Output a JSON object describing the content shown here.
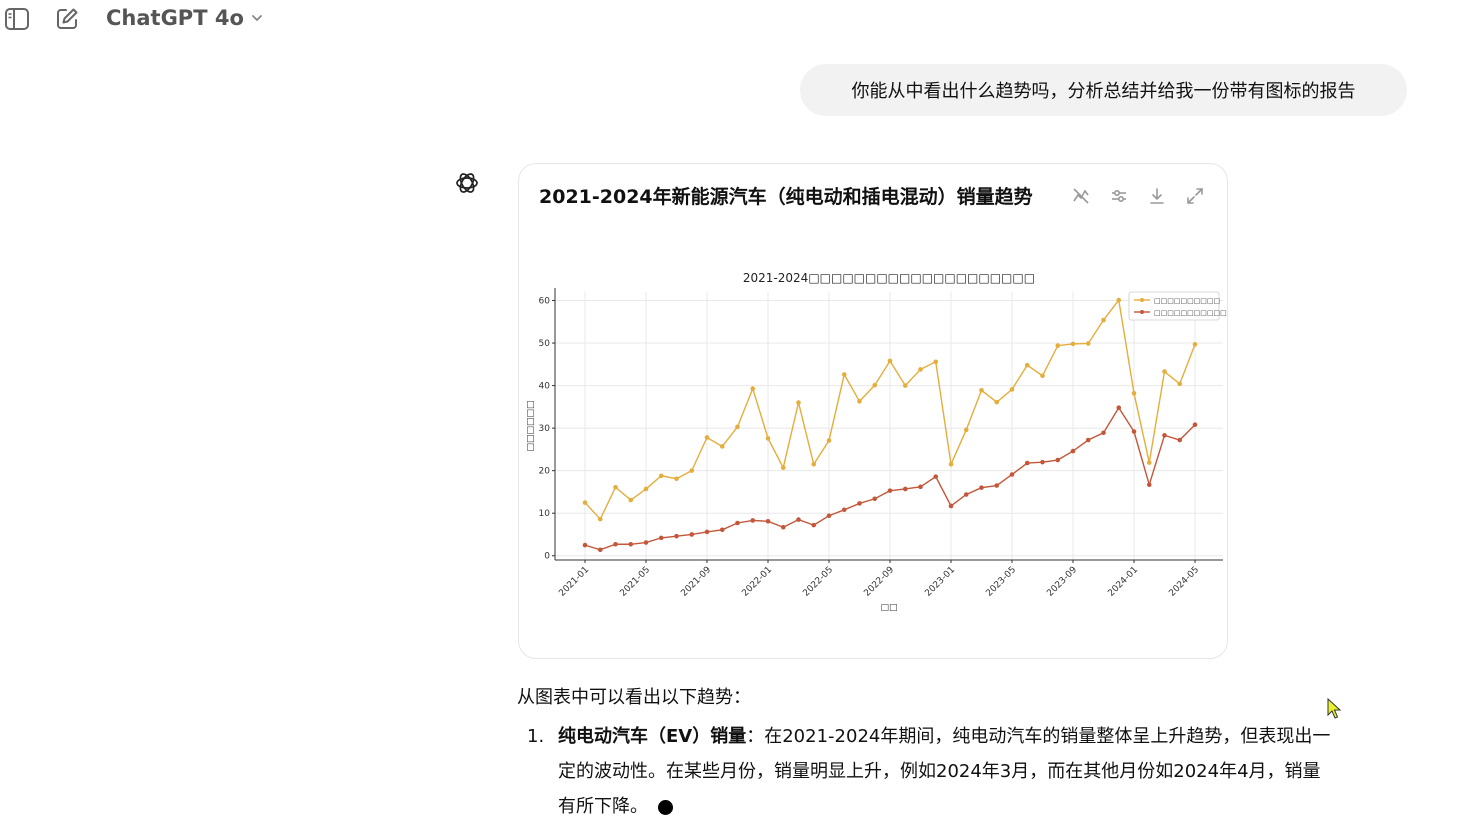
{
  "header": {
    "model_name": "ChatGPT 4o",
    "icons": [
      "sidebar-toggle-icon",
      "new-chat-icon",
      "chevron-down-icon"
    ]
  },
  "user_message": "你能从中看出什么趋势吗，分析总结并给我一份带有图标的报告",
  "chart_card": {
    "title": "2021-2024年新能源汽车（纯电动和插电混动）销量趋势",
    "tools": [
      "chart-switch-icon",
      "chart-settings-icon",
      "download-icon",
      "expand-icon"
    ]
  },
  "chart_data": {
    "type": "line",
    "title": "2021-2024□□□□□□□□□□□□□□□□□□□□",
    "xlabel": "□□",
    "ylabel": "□□□□□□",
    "ylim": [
      -1,
      62
    ],
    "yticks": [
      0,
      10,
      20,
      30,
      40,
      50,
      60
    ],
    "x_start": "2021-01",
    "x_end": "2024-05",
    "xticks": [
      "2021-01",
      "2021-05",
      "2021-09",
      "2022-01",
      "2022-05",
      "2022-09",
      "2023-01",
      "2023-05",
      "2023-09",
      "2024-01",
      "2024-05"
    ],
    "grid": true,
    "legend_position": "top-right",
    "series": [
      {
        "name": "□□□□□□□□□□",
        "color": "#e5ad3c",
        "values": [
          12.5,
          8.6,
          16.1,
          13.1,
          15.7,
          18.8,
          18.1,
          20.0,
          27.8,
          25.7,
          30.3,
          39.3,
          27.6,
          20.7,
          36.0,
          21.5,
          27.1,
          42.6,
          36.3,
          40.1,
          45.8,
          40.0,
          43.8,
          45.6,
          21.5,
          29.6,
          38.9,
          36.1,
          39.1,
          44.8,
          42.3,
          49.4,
          49.8,
          49.9,
          55.4,
          60.1,
          38.2,
          21.9,
          43.3,
          40.4,
          49.7
        ]
      },
      {
        "name": "□□□□□□□□□□□",
        "color": "#c4573a",
        "values": [
          2.5,
          1.4,
          2.7,
          2.7,
          3.1,
          4.2,
          4.6,
          5.0,
          5.6,
          6.1,
          7.7,
          8.3,
          8.1,
          6.7,
          8.5,
          7.2,
          9.4,
          10.8,
          12.3,
          13.4,
          15.3,
          15.7,
          16.2,
          18.6,
          11.7,
          14.4,
          16.0,
          16.5,
          19.1,
          21.8,
          22.0,
          22.5,
          24.6,
          27.2,
          28.9,
          34.8,
          29.2,
          16.7,
          28.3,
          27.2,
          30.8
        ]
      }
    ]
  },
  "response": {
    "intro": "从图表中可以看出以下趋势：",
    "items": [
      {
        "number": "1.",
        "bold": "纯电动汽车（EV）销量",
        "lines": [
          "：在2021-2024年期间，纯电动汽车的销量整体呈上升趋势，但表现出一",
          "定的波动性。在某些月份，销量明显上升，例如2024年3月，而在其他月份如2024年4月，销量",
          "有所下降。"
        ]
      }
    ]
  }
}
